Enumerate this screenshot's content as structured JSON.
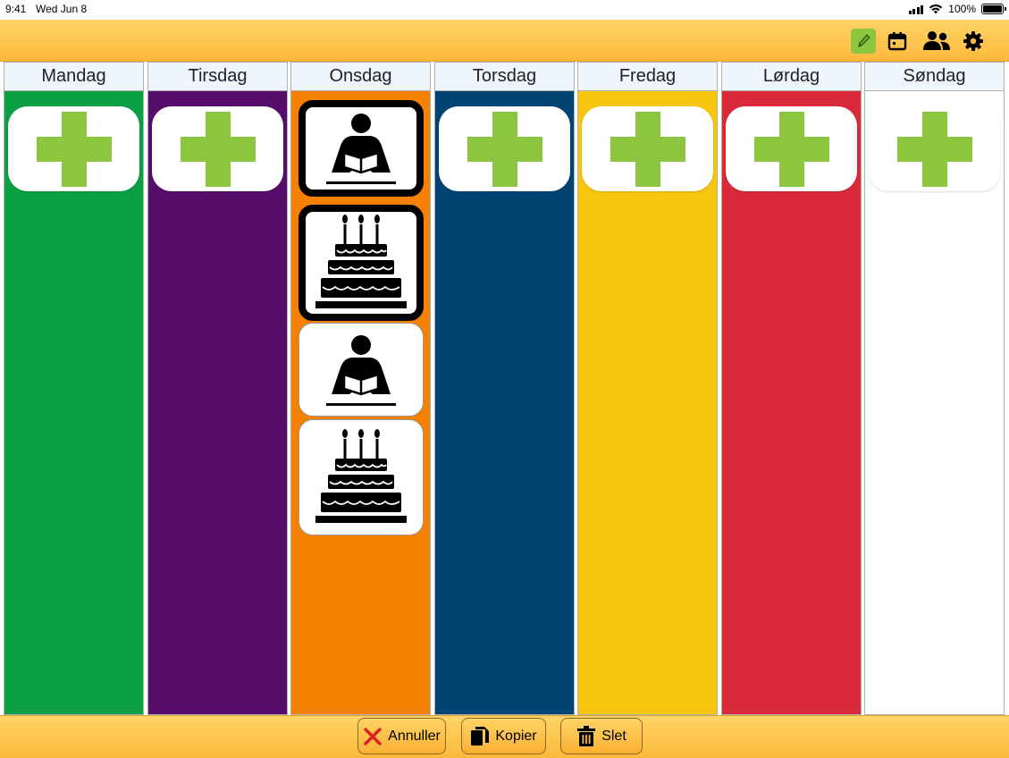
{
  "status_bar": {
    "time": "9:41",
    "date": "Wed Jun 8",
    "battery": "100%",
    "icons": [
      "signal-icon",
      "wifi-icon",
      "battery-icon"
    ]
  },
  "toolbar": {
    "icons": [
      "edit-pencil-icon",
      "calendar-icon",
      "people-icon",
      "gear-icon"
    ],
    "active": "edit-pencil-icon",
    "active_color": "#8cc63f"
  },
  "days": [
    {
      "name": "Mandag",
      "color": "#0aa043",
      "items": [
        "add"
      ]
    },
    {
      "name": "Tirsdag",
      "color": "#560d6b",
      "items": [
        "add"
      ]
    },
    {
      "name": "Onsdag",
      "color": "#f58001",
      "items": [
        "reading-icon",
        "birthday-cake-icon",
        "reading-icon",
        "birthday-cake-icon"
      ]
    },
    {
      "name": "Torsdag",
      "color": "#004474",
      "items": [
        "add"
      ]
    },
    {
      "name": "Fredag",
      "color": "#f8c511",
      "items": [
        "add"
      ]
    },
    {
      "name": "Lørdag",
      "color": "#d92a3a",
      "items": [
        "add"
      ]
    },
    {
      "name": "Søndag",
      "color": "#ffffff",
      "items": [
        "add"
      ]
    }
  ],
  "bottom_bar": {
    "cancel_label": "Annuller",
    "copy_label": "Kopier",
    "delete_label": "Slet"
  },
  "colors": {
    "bar": "#fcb93c",
    "add_plus": "#8cc63f",
    "header_bg": "#eef5fc",
    "cancel_icon": "#e02020"
  }
}
